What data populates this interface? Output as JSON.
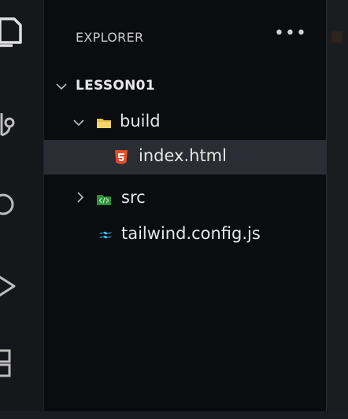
{
  "explorer": {
    "title": "EXPLORER",
    "more": "•••"
  },
  "tree": {
    "root": "LESSON01",
    "build": "build",
    "index": "index.html",
    "src": "src",
    "tailwind": "tailwind.config.js"
  },
  "icons": {
    "activity": [
      "files-icon",
      "source-control-icon",
      "search-icon",
      "run-debug-icon",
      "extensions-icon"
    ],
    "html_color": "#e44d26",
    "folder_color": "#e8c14a",
    "src_color": "#3fb34f",
    "tailwind_color": "#38bdf8"
  }
}
